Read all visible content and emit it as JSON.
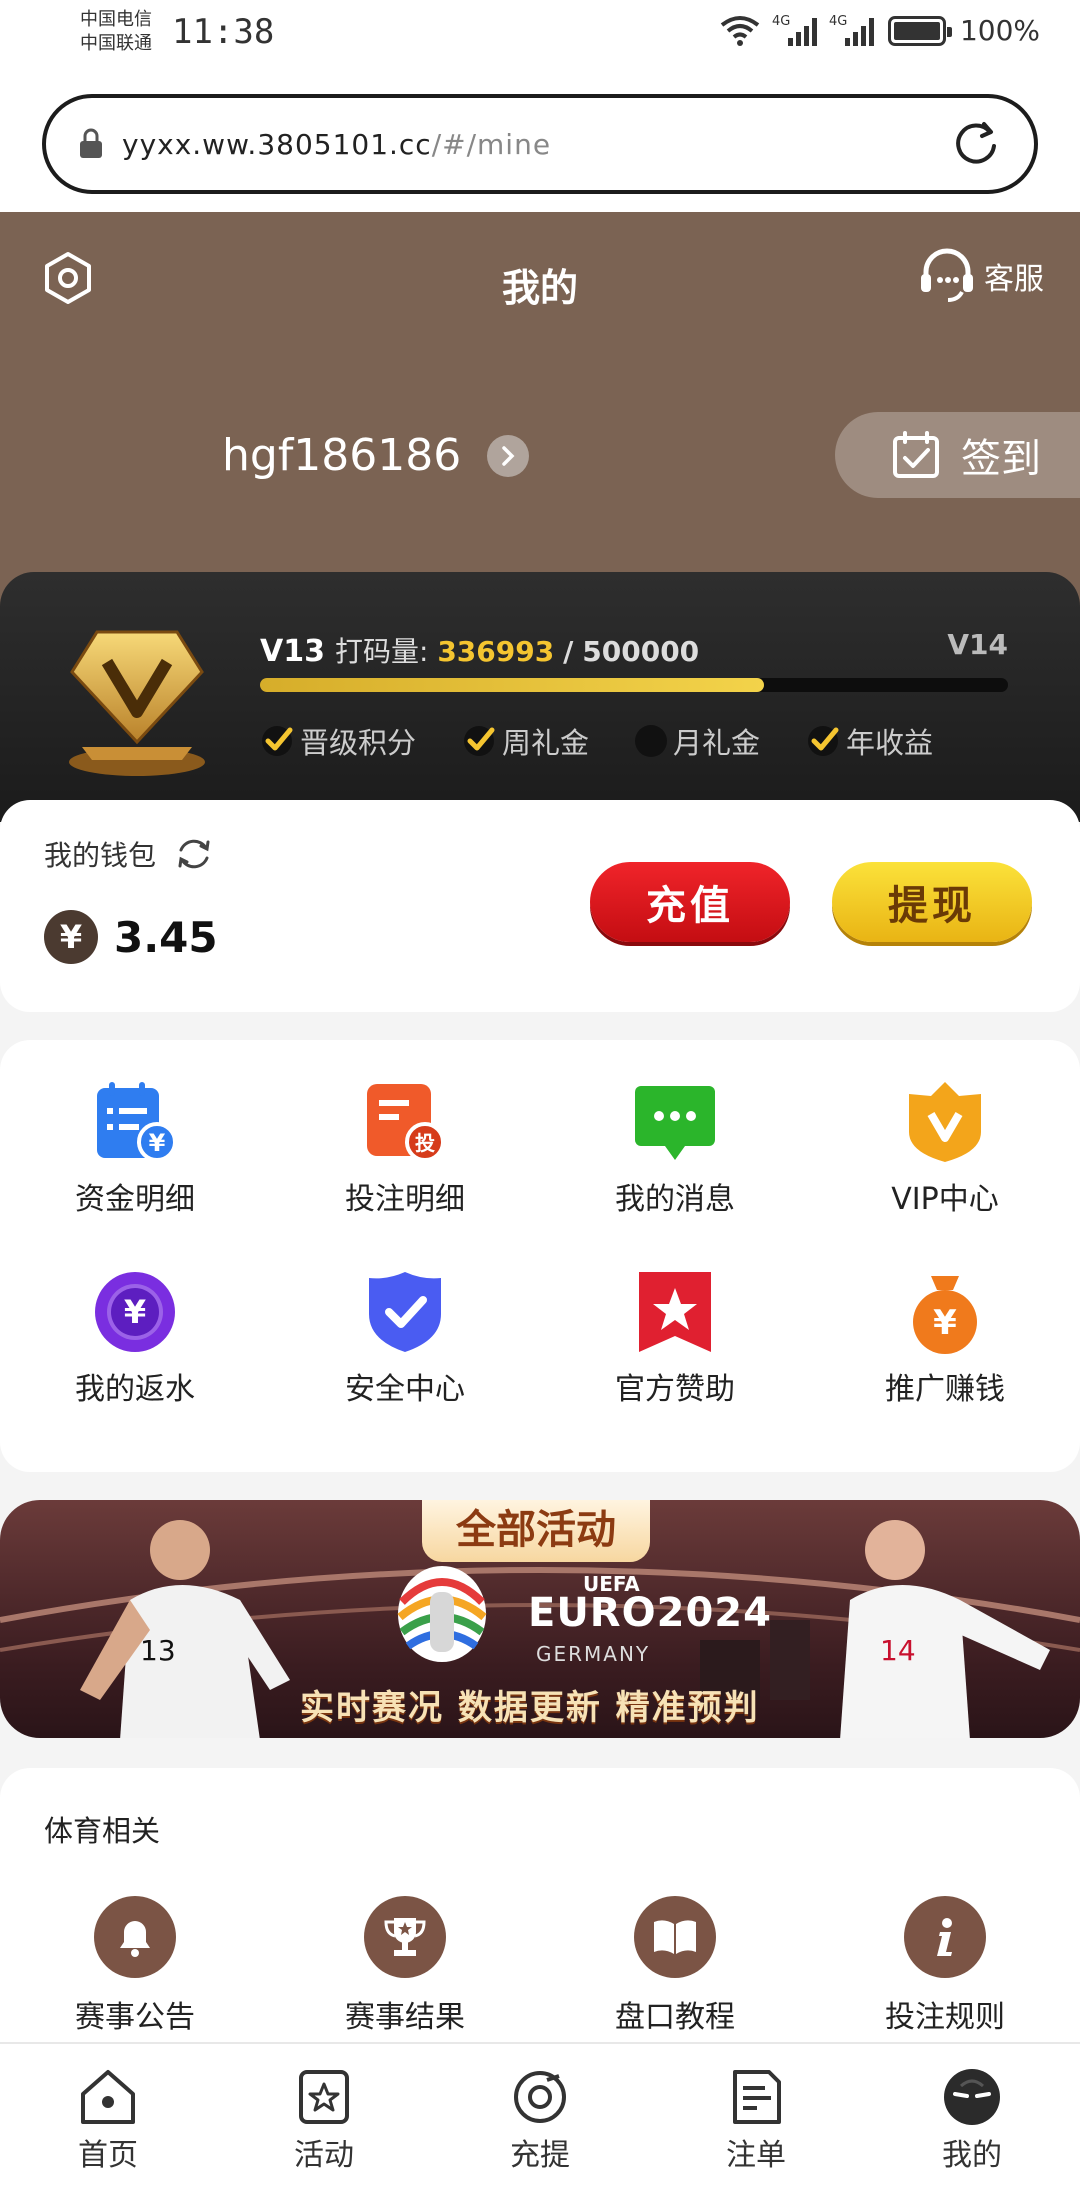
{
  "status_bar": {
    "carrier1": "中国电信",
    "carrier2": "中国联通",
    "time": "11:38",
    "network1": "4G",
    "network2": "4G",
    "battery": "100%"
  },
  "url_bar": {
    "domain": "yyxx.ww.3805101.cc",
    "path": "/#/mine"
  },
  "header": {
    "title": "我的",
    "customer_service": "客服",
    "username": "hgf186186",
    "checkin": "签到"
  },
  "vip": {
    "current_level": "V13",
    "label": "打码量:",
    "current": "336993",
    "separator": "/",
    "target": "500000",
    "next_level": "V14",
    "progress": 0.674,
    "perks": [
      {
        "label": "晋级积分",
        "checked": true
      },
      {
        "label": "周礼金",
        "checked": true
      },
      {
        "label": "月礼金",
        "checked": false
      },
      {
        "label": "年收益",
        "checked": true
      }
    ]
  },
  "wallet": {
    "label": "我的钱包",
    "currency_symbol": "¥",
    "balance": "3.45",
    "deposit": "充值",
    "withdraw": "提现"
  },
  "menu": [
    {
      "label": "资金明细",
      "icon": "fund-details-icon",
      "color": "#2f7df0"
    },
    {
      "label": "投注明细",
      "icon": "bet-details-icon",
      "color": "#f05a2a"
    },
    {
      "label": "我的消息",
      "icon": "message-icon",
      "color": "#2bb52b"
    },
    {
      "label": "VIP中心",
      "icon": "vip-crown-icon",
      "color": "#f3a51b"
    },
    {
      "label": "我的返水",
      "icon": "rebate-icon",
      "color": "#7a2ee0"
    },
    {
      "label": "安全中心",
      "icon": "shield-icon",
      "color": "#4a5cf2"
    },
    {
      "label": "官方赞助",
      "icon": "star-flag-icon",
      "color": "#e02030"
    },
    {
      "label": "推广赚钱",
      "icon": "money-bag-icon",
      "color": "#f07a1c"
    }
  ],
  "banner": {
    "tag": "全部活动",
    "uefa": "UEFA",
    "euro": "EURO2024",
    "country": "GERMANY",
    "slogan": "实时赛况 数据更新 精准预判"
  },
  "sports": {
    "title": "体育相关",
    "items": [
      {
        "label": "赛事公告",
        "icon": "bell-icon"
      },
      {
        "label": "赛事结果",
        "icon": "trophy-icon"
      },
      {
        "label": "盘口教程",
        "icon": "book-icon"
      },
      {
        "label": "投注规则",
        "icon": "info-icon"
      }
    ]
  },
  "tabbar": [
    {
      "label": "首页",
      "icon": "home-icon",
      "active": false
    },
    {
      "label": "活动",
      "icon": "activity-icon",
      "active": false
    },
    {
      "label": "充提",
      "icon": "deposit-withdraw-icon",
      "active": false
    },
    {
      "label": "注单",
      "icon": "bet-slip-icon",
      "active": false
    },
    {
      "label": "我的",
      "icon": "profile-icon",
      "active": true
    }
  ]
}
